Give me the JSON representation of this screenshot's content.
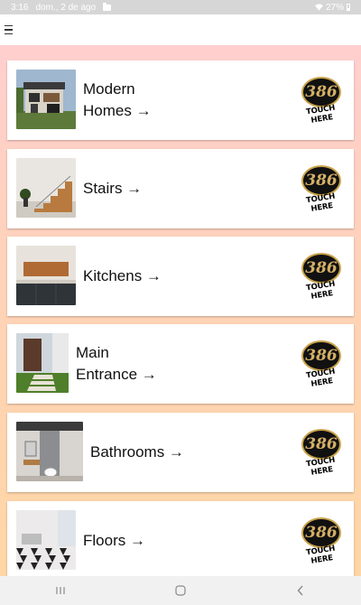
{
  "status_bar": {
    "time": "3:16",
    "date": "dom., 2 de ago",
    "battery": "27%"
  },
  "app_bar": {
    "menu_icon": "hamburger-icon"
  },
  "badge": {
    "number": "386",
    "caption": "TOUCH HERE"
  },
  "items": [
    {
      "label": "Modern\nHomes →",
      "thumbnail": "modern-home-icon"
    },
    {
      "label": "Stairs →",
      "thumbnail": "stairs-icon"
    },
    {
      "label": "Kitchens →",
      "thumbnail": "kitchen-icon"
    },
    {
      "label": "Main\nEntrance →",
      "thumbnail": "entrance-icon"
    },
    {
      "label": "Bathrooms →",
      "thumbnail": "bathroom-icon"
    },
    {
      "label": "Floors →",
      "thumbnail": "floor-icon"
    }
  ],
  "nav_bar": {
    "icons": [
      "recent-apps-icon",
      "home-icon",
      "back-icon"
    ]
  }
}
